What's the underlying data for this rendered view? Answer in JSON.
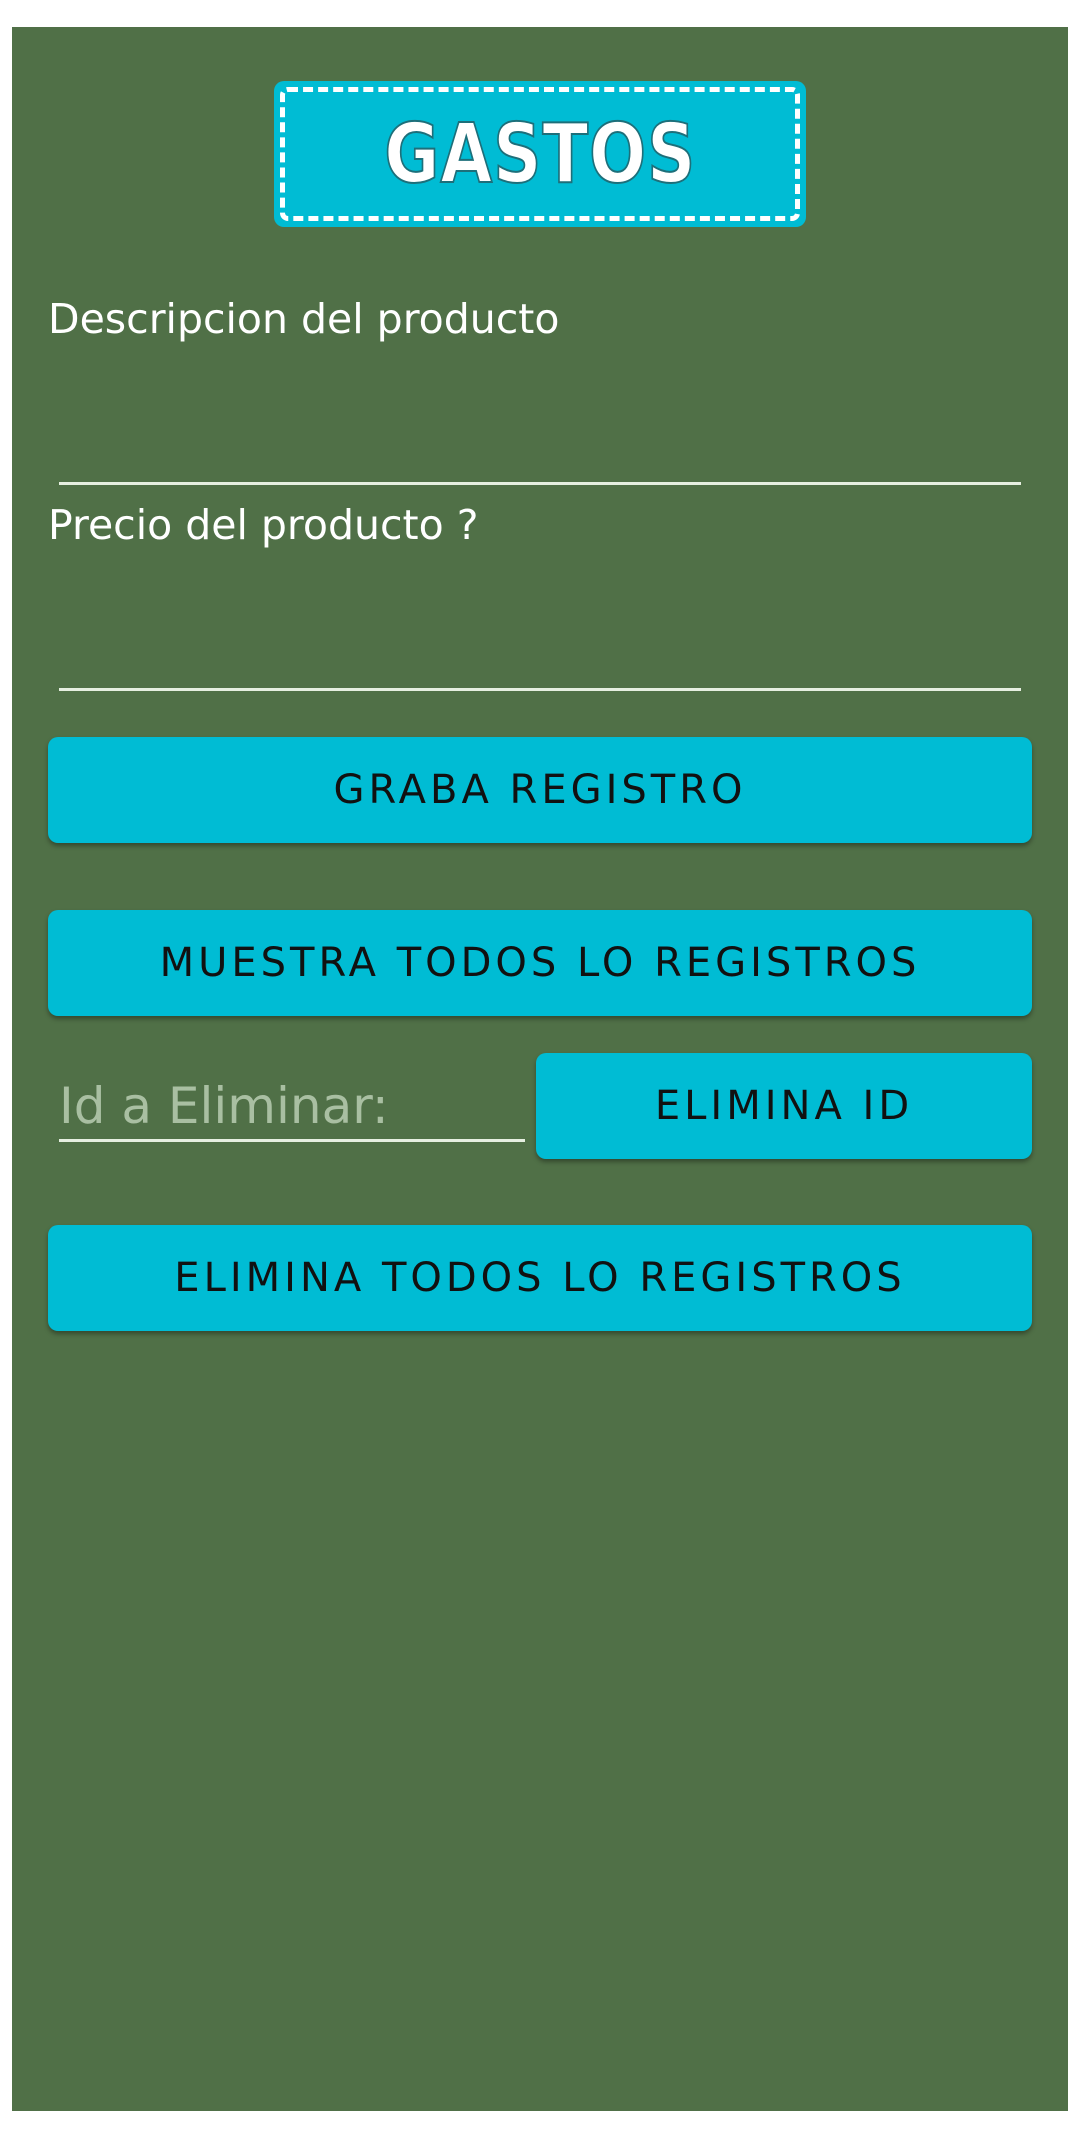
{
  "header": {
    "title": "GASTOS"
  },
  "form": {
    "description_label": "Descripcion del producto",
    "description_value": "",
    "price_label": "Precio del producto ?",
    "price_value": ""
  },
  "buttons": {
    "save": "GRABA REGISTRO",
    "show_all": "MUESTRA TODOS LO REGISTROS",
    "delete_id": "ELIMINA ID",
    "delete_all": "ELIMINA TODOS LO REGISTROS"
  },
  "delete_by_id": {
    "placeholder": "Id a Eliminar:",
    "value": ""
  },
  "colors": {
    "background": "#507047",
    "accent": "#00bcd4",
    "text_light": "#ffffff",
    "button_text": "#111111"
  }
}
